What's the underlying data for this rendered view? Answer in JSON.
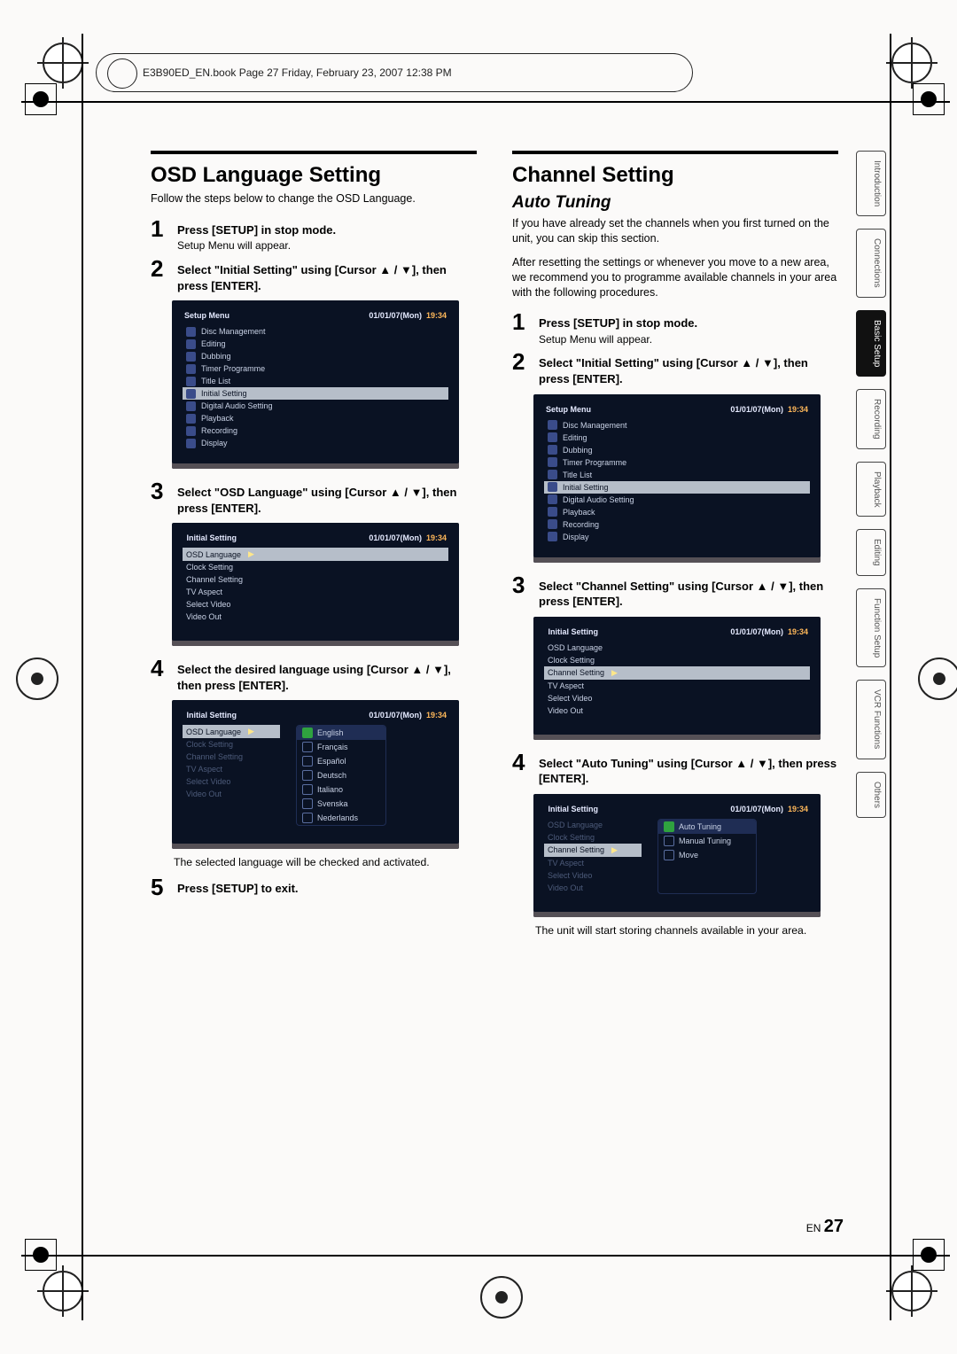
{
  "running_head": "E3B90ED_EN.book  Page 27  Friday, February 23, 2007  12:38 PM",
  "page_num_prefix": "EN",
  "page_num": "27",
  "side_tabs": [
    "Introduction",
    "Connections",
    "Basic Setup",
    "Recording",
    "Playback",
    "Editing",
    "Function Setup",
    "VCR Functions",
    "Others"
  ],
  "side_tab_active_index": 2,
  "left": {
    "title": "OSD Language Setting",
    "lead": "Follow the steps below to change the OSD Language.",
    "steps": [
      {
        "num": "1",
        "bold": "Press [SETUP] in stop mode.",
        "sub": "Setup Menu will appear."
      },
      {
        "num": "2",
        "bold": "Select \"Initial Setting\" using [Cursor ▲ / ▼], then press [ENTER]."
      },
      {
        "num": "3",
        "bold": "Select \"OSD Language\" using [Cursor ▲ / ▼], then press [ENTER]."
      },
      {
        "num": "4",
        "bold": "Select the desired language using [Cursor ▲ / ▼], then press [ENTER]."
      },
      {
        "num": "5",
        "bold": "Press [SETUP] to exit."
      }
    ],
    "caption_after_4": "The selected language will be checked and activated."
  },
  "right": {
    "title": "Channel Setting",
    "subtitle": "Auto Tuning",
    "lead1": "If you have already set the channels when you first turned on the unit, you can skip this section.",
    "lead2": "After resetting the settings or whenever you move to a new area, we recommend you to programme available channels in your area with the following procedures.",
    "steps": [
      {
        "num": "1",
        "bold": "Press [SETUP] in stop mode.",
        "sub": "Setup Menu will appear."
      },
      {
        "num": "2",
        "bold": "Select \"Initial Setting\" using [Cursor ▲ / ▼], then press [ENTER]."
      },
      {
        "num": "3",
        "bold": "Select \"Channel Setting\" using [Cursor ▲ / ▼], then press [ENTER]."
      },
      {
        "num": "4",
        "bold": "Select \"Auto Tuning\" using [Cursor ▲ / ▼], then press [ENTER]."
      }
    ],
    "caption_after_4": "The unit will start storing channels available in your area."
  },
  "tv_common": {
    "date": "01/01/07(Mon)",
    "time": "19:34"
  },
  "tv_setup_menu": {
    "title": "Setup Menu",
    "items": [
      "Disc Management",
      "Editing",
      "Dubbing",
      "Timer Programme",
      "Title List",
      "Initial Setting",
      "Digital Audio Setting",
      "Playback",
      "Recording",
      "Display"
    ],
    "hi_index": 5
  },
  "tv_initial_setting": {
    "title": "Initial Setting",
    "items": [
      "OSD Language",
      "Clock Setting",
      "Channel Setting",
      "TV Aspect",
      "Select Video",
      "Video Out"
    ]
  },
  "osd_lang_options": [
    "English",
    "Français",
    "Español",
    "Deutsch",
    "Italiano",
    "Svenska",
    "Nederlands"
  ],
  "channel_setting_options": [
    "Auto Tuning",
    "Manual Tuning",
    "Move"
  ]
}
